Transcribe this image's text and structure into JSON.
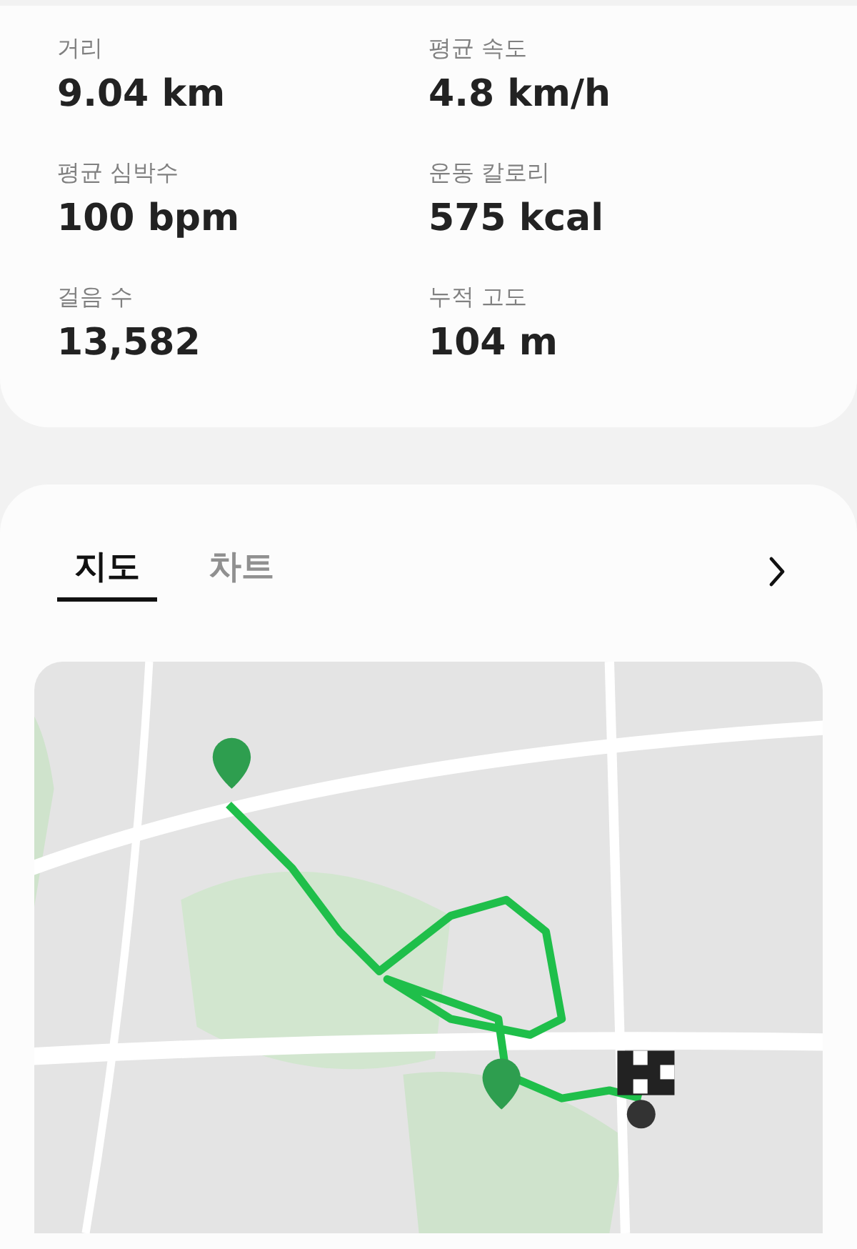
{
  "stats": [
    {
      "label": "거리",
      "value": "9.04 km"
    },
    {
      "label": "평균 속도",
      "value": "4.8 km/h"
    },
    {
      "label": "평균 심박수",
      "value": "100 bpm"
    },
    {
      "label": "운동 칼로리",
      "value": "575 kcal"
    },
    {
      "label": "걸음 수",
      "value": "13,582"
    },
    {
      "label": "누적 고도",
      "value": "104 m"
    }
  ],
  "tabs": [
    {
      "label": "지도",
      "selected": true
    },
    {
      "label": "차트",
      "selected": false
    }
  ]
}
